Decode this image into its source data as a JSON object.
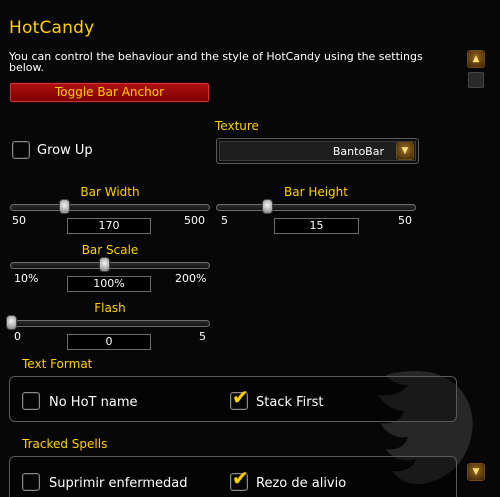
{
  "header": {
    "title": "HotCandy",
    "description": "You can control the behaviour and the style of HotCandy using the settings below."
  },
  "buttons": {
    "toggle_anchor": "Toggle Bar Anchor"
  },
  "options": {
    "grow_up": {
      "label": "Grow Up",
      "checked": false
    }
  },
  "texture": {
    "label": "Texture",
    "value": "BantoBar"
  },
  "sliders": {
    "bar_width": {
      "label": "Bar Width",
      "min": "50",
      "max": "500",
      "value": "170",
      "fraction": 0.27
    },
    "bar_height": {
      "label": "Bar Height",
      "min": "5",
      "max": "50",
      "value": "15",
      "fraction": 0.25
    },
    "bar_scale": {
      "label": "Bar Scale",
      "min": "10%",
      "max": "200%",
      "value": "100%",
      "fraction": 0.47
    },
    "flash": {
      "label": "Flash",
      "min": "0",
      "max": "5",
      "value": "0",
      "fraction": 0.0
    }
  },
  "text_format": {
    "heading": "Text Format",
    "no_hot_name": {
      "label": "No HoT name",
      "checked": false
    },
    "stack_first": {
      "label": "Stack First",
      "checked": true
    }
  },
  "tracked_spells": {
    "heading": "Tracked Spells",
    "items": [
      {
        "label": "Suprimir enfermedad",
        "checked": false
      },
      {
        "label": "Rezo de alivio",
        "checked": true
      }
    ]
  },
  "colors": {
    "gold": "#ffd100",
    "button_red": "#a00000",
    "background": "#070707"
  }
}
